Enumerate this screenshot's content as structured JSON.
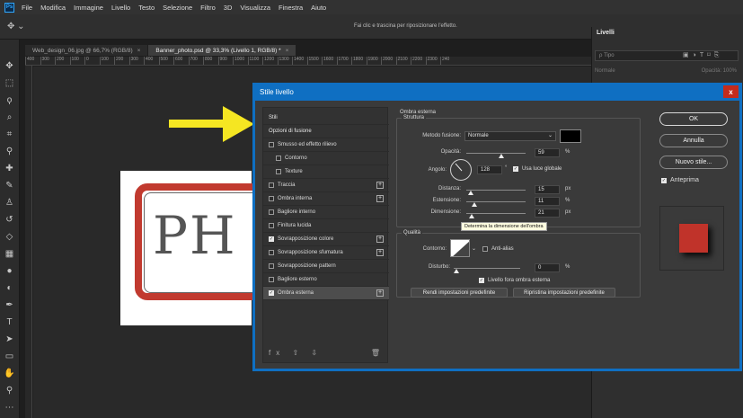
{
  "menubar": {
    "logo": "Ps",
    "items": [
      "File",
      "Modifica",
      "Immagine",
      "Livello",
      "Testo",
      "Selezione",
      "Filtro",
      "3D",
      "Visualizza",
      "Finestra",
      "Aiuto"
    ]
  },
  "optionsbar": {
    "hint": "Fai clic e trascina per riposizionare l'effetto."
  },
  "tabs": [
    {
      "label": "Web_design_06.jpg @ 66,7% (RGB/8)",
      "close": "×"
    },
    {
      "label": "Banner_photo.psd @ 33,3% (Livello 1, RGB/8) *",
      "close": "×"
    }
  ],
  "ruler": [
    "400",
    "300",
    "200",
    "100",
    "0",
    "100",
    "200",
    "300",
    "400",
    "500",
    "600",
    "700",
    "800",
    "900",
    "1000",
    "1100",
    "1200",
    "1300",
    "1400",
    "1500",
    "1600",
    "1700",
    "1800",
    "1900",
    "2000",
    "2100",
    "2200",
    "2300",
    "240"
  ],
  "canvas": {
    "badge_text": "PH",
    "arrow_color": "#f5e622",
    "badge_color": "#c13a2f"
  },
  "layers_panel": {
    "tab": "Livelli",
    "search_placeholder": "ρ Tipo",
    "blend": "Normale",
    "opacity": "Opacità: 100%"
  },
  "dialog": {
    "title": "Stile livello",
    "close": "x",
    "styles": [
      {
        "label": "Stili",
        "type": "header"
      },
      {
        "label": "Opzioni di fusione",
        "type": "header"
      },
      {
        "label": "Smusso ed effetto rilievo",
        "checked": false
      },
      {
        "label": "Contorno",
        "checked": false,
        "indent": true
      },
      {
        "label": "Texture",
        "checked": false,
        "indent": true
      },
      {
        "label": "Traccia",
        "checked": false,
        "plus": true
      },
      {
        "label": "Ombra interna",
        "checked": false,
        "plus": true
      },
      {
        "label": "Bagliore interno",
        "checked": false
      },
      {
        "label": "Finitura lucida",
        "checked": false
      },
      {
        "label": "Sovrapposizione colore",
        "checked": true,
        "plus": true
      },
      {
        "label": "Sovrapposizione sfumatura",
        "checked": false,
        "plus": true
      },
      {
        "label": "Sovrapposizione pattern",
        "checked": false
      },
      {
        "label": "Bagliore esterno",
        "checked": false
      },
      {
        "label": "Ombra esterna",
        "checked": true,
        "plus": true,
        "selected": true
      }
    ],
    "footer_icons": "fx ⇧ ⇩",
    "section_title": "Ombra esterna",
    "struttura": {
      "title": "Struttura",
      "blend_label": "Metodo fusione:",
      "blend_value": "Normale",
      "opacity_label": "Opacità:",
      "opacity_value": "59",
      "opacity_unit": "%",
      "opacity_level": 0.59,
      "angle_label": "Angolo:",
      "angle_value": "128",
      "angle_unit": "°",
      "global_light": "Usa luce globale",
      "distance_label": "Distanza:",
      "distance_value": "15",
      "distance_unit": "px",
      "spread_label": "Estensione:",
      "spread_value": "11",
      "spread_unit": "%",
      "size_label": "Dimensione:",
      "size_value": "21",
      "size_unit": "px",
      "tooltip": "Determina la dimensione dell'ombra"
    },
    "qualita": {
      "title": "Qualità",
      "contour_label": "Contorno:",
      "antialias": "Anti-alias",
      "noise_label": "Disturbo:",
      "noise_value": "0",
      "noise_unit": "%",
      "knockout": "Livello fora ombra esterna",
      "btn_default": "Rendi impostazioni predefinite",
      "btn_reset": "Ripristina impostazioni predefinite"
    },
    "buttons": {
      "ok": "OK",
      "cancel": "Annulla",
      "new_style": "Nuovo stile...",
      "preview": "Anteprima"
    },
    "preview_color": "#c0332a"
  }
}
